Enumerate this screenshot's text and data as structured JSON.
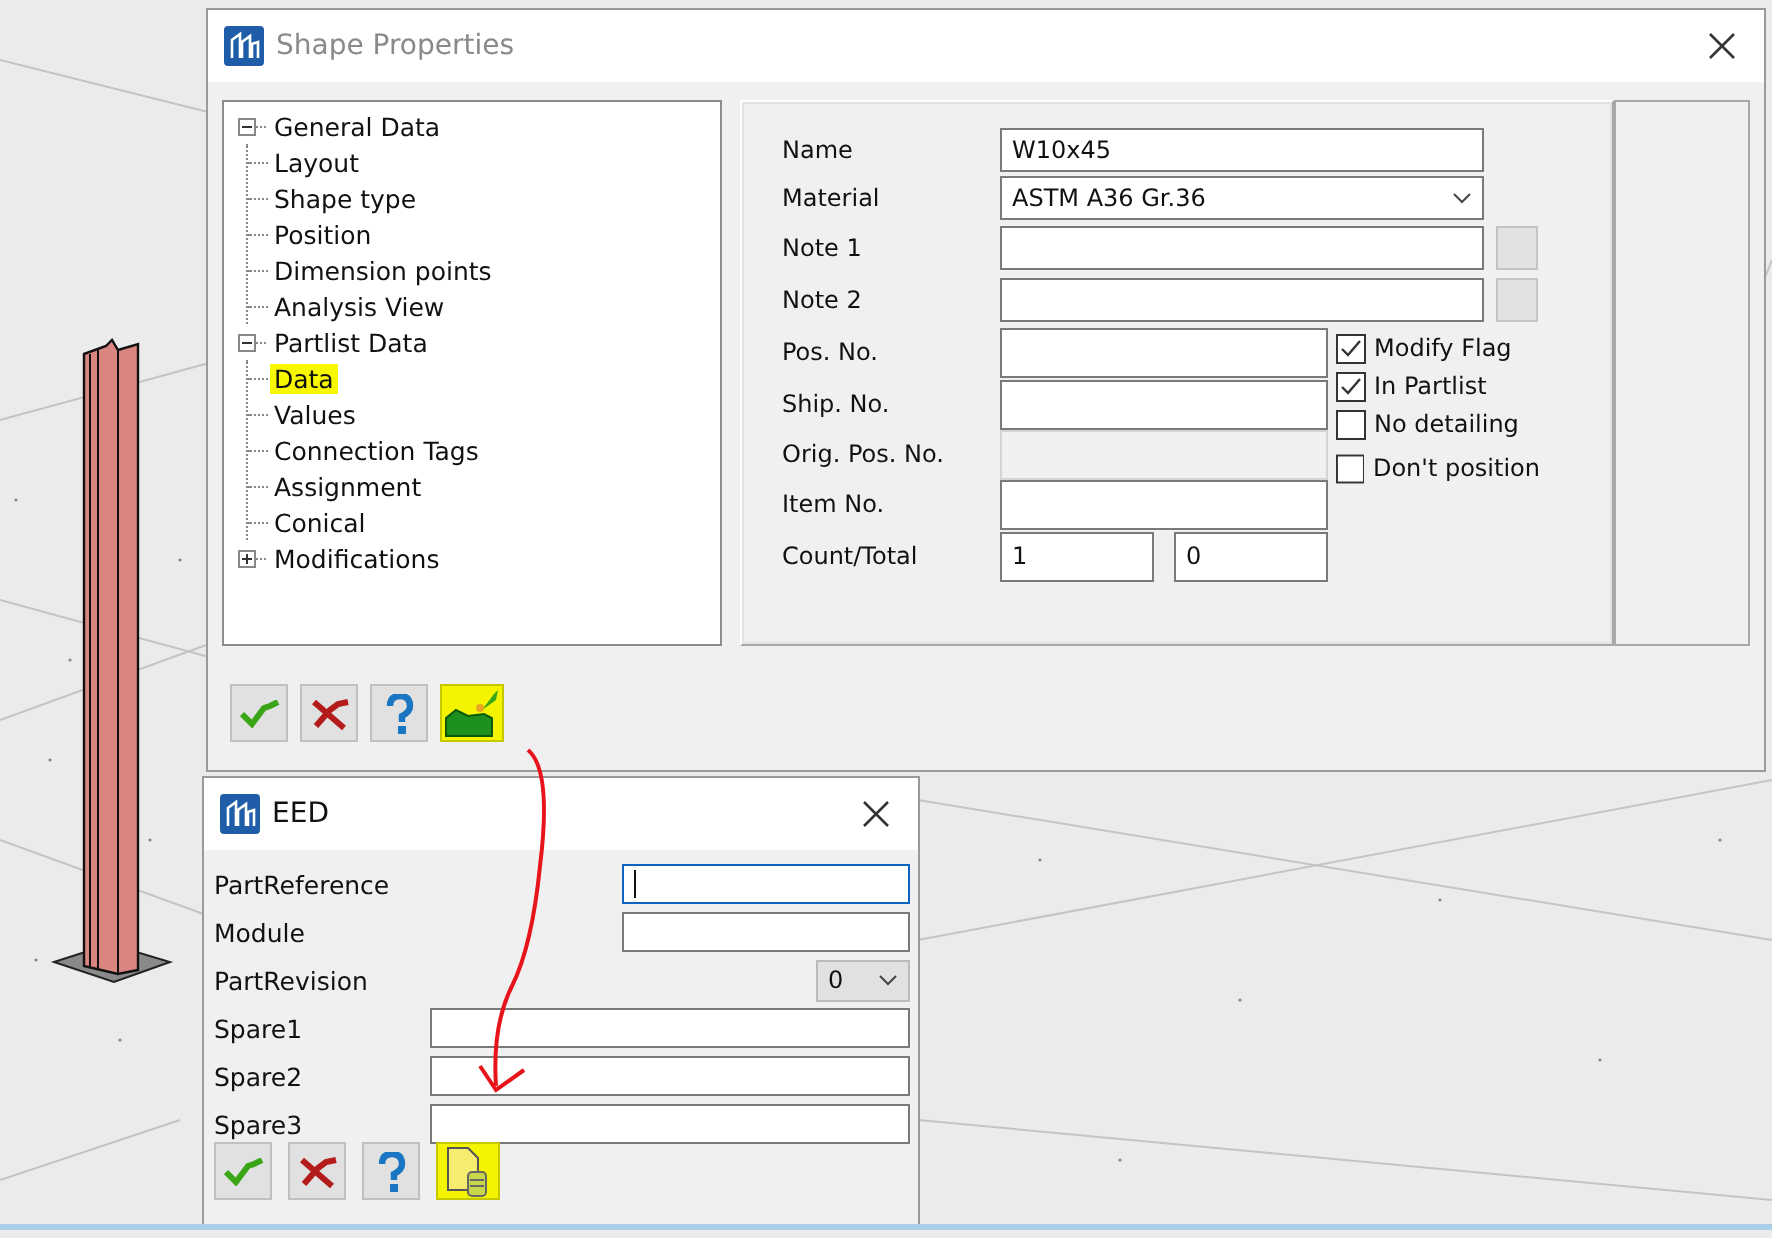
{
  "shape_dialog": {
    "title": "Shape Properties",
    "tree": [
      {
        "label": "General Data",
        "expanded": true,
        "highlighted": false,
        "children": [
          {
            "label": "Layout",
            "highlighted": false
          },
          {
            "label": "Shape type",
            "highlighted": false
          },
          {
            "label": "Position",
            "highlighted": false
          },
          {
            "label": "Dimension points",
            "highlighted": false
          },
          {
            "label": "Analysis View",
            "highlighted": false
          }
        ]
      },
      {
        "label": "Partlist Data",
        "expanded": true,
        "highlighted": false,
        "children": [
          {
            "label": "Data",
            "highlighted": true
          },
          {
            "label": "Values",
            "highlighted": false
          },
          {
            "label": "Connection Tags",
            "highlighted": false
          },
          {
            "label": "Assignment",
            "highlighted": false
          },
          {
            "label": "Conical",
            "highlighted": false
          }
        ]
      },
      {
        "label": "Modifications",
        "expanded": false,
        "highlighted": false
      }
    ],
    "fields": [
      {
        "label": "Name",
        "kind": "text",
        "value": "W10x45"
      },
      {
        "label": "Material",
        "kind": "combo",
        "value": "ASTM A36 Gr.36"
      },
      {
        "label": "Note 1",
        "kind": "text_button"
      },
      {
        "label": "Note 2",
        "kind": "text_button"
      },
      {
        "label": "Pos. No.",
        "kind": "short"
      },
      {
        "label": "Ship. No.",
        "kind": "short"
      },
      {
        "label": "Orig. Pos. No.",
        "kind": "disabled"
      },
      {
        "label": "Item No.",
        "kind": "short"
      },
      {
        "label": "Count/Total",
        "kind": "pair",
        "values": [
          "1",
          "0"
        ]
      }
    ],
    "checkboxes": [
      {
        "label": "Modify Flag",
        "checked": true
      },
      {
        "label": "In Partlist",
        "checked": true
      },
      {
        "label": "No detailing",
        "checked": false
      },
      {
        "label": "Don't position",
        "checked": false
      }
    ],
    "buttons": [
      {
        "kind": "ok",
        "highlighted": false
      },
      {
        "kind": "cancel",
        "highlighted": false
      },
      {
        "kind": "help",
        "highlighted": false
      },
      {
        "kind": "eed",
        "highlighted": true
      }
    ]
  },
  "eed_dialog": {
    "title": "EED",
    "fields": [
      {
        "label": "PartReference",
        "kind": "short",
        "focused": true
      },
      {
        "label": "Module",
        "kind": "short",
        "focused": false
      },
      {
        "label": "PartRevision",
        "kind": "combo",
        "value": "0",
        "focused": false
      },
      {
        "label": "Spare1",
        "kind": "wide",
        "focused": false
      },
      {
        "label": "Spare2",
        "kind": "wide",
        "focused": false
      },
      {
        "label": "Spare3",
        "kind": "wide",
        "focused": false
      }
    ],
    "buttons": [
      {
        "kind": "ok",
        "highlighted": false
      },
      {
        "kind": "cancel",
        "highlighted": false
      },
      {
        "kind": "help",
        "highlighted": false
      },
      {
        "kind": "attributes",
        "highlighted": true
      }
    ]
  }
}
